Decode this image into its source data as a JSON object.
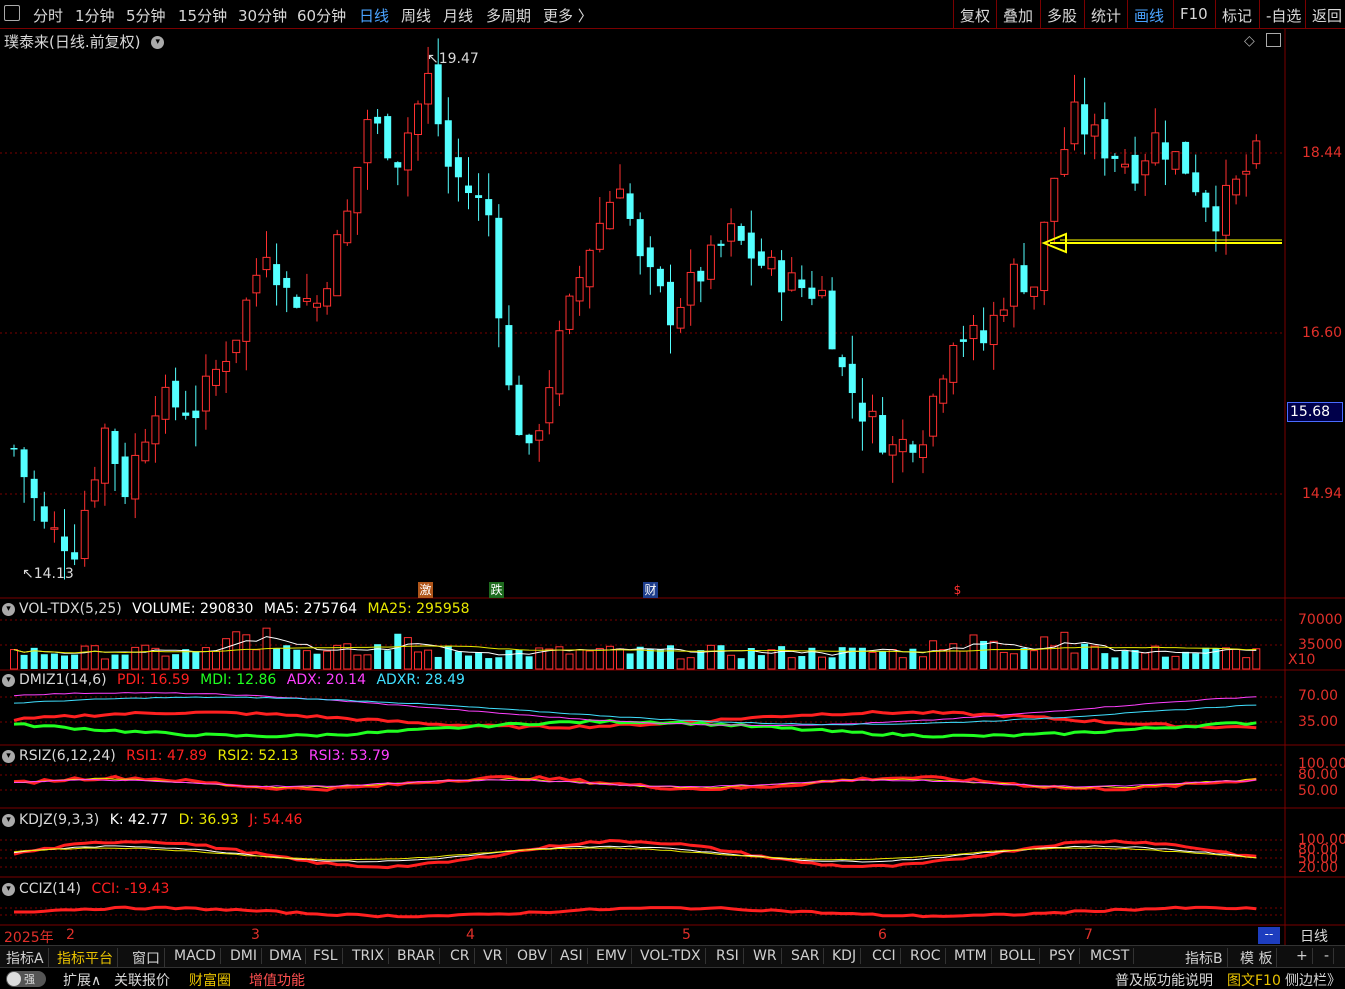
{
  "topbar": {
    "periods": [
      "分时",
      "1分钟",
      "5分钟",
      "15分钟",
      "30分钟",
      "60分钟",
      "日线",
      "周线",
      "月线",
      "多周期",
      "更多 〉"
    ],
    "active_period": "日线",
    "right_tools": [
      "复权",
      "叠加",
      "多股",
      "统计",
      "画线",
      "F10",
      "标记",
      "-自选",
      "返回"
    ],
    "highlighted_tool": "画线"
  },
  "main": {
    "title": "璞泰来(日线.前复权)",
    "high_label": "19.47",
    "low_label": "14.13",
    "axis": [
      "18.44",
      "16.60",
      "14.94"
    ],
    "current_price": "15.68",
    "markers": [
      "激",
      "跌",
      "财",
      "$"
    ]
  },
  "volume": {
    "name": "VOL-TDX(5,25)",
    "v1": "VOLUME: 290830",
    "v2": "MA5: 275764",
    "v3": "MA25: 295958",
    "axis": [
      "70000",
      "35000",
      "X10"
    ]
  },
  "dmi": {
    "name": "DMIZ1(14,6)",
    "v1": "PDI: 16.59",
    "v2": "MDI: 12.86",
    "v3": "ADX: 20.14",
    "v4": "ADXR: 28.49",
    "axis": [
      "70.00",
      "35.00"
    ]
  },
  "rsi": {
    "name": "RSIZ(6,12,24)",
    "v1": "RSI1: 47.89",
    "v2": "RSI2: 52.13",
    "v3": "RSI3: 53.79",
    "axis": [
      "100.00",
      "80.00",
      "50.00"
    ]
  },
  "kdj": {
    "name": "KDJZ(9,3,3)",
    "v1": "K: 42.77",
    "v2": "D: 36.93",
    "v3": "J: 54.46",
    "axis": [
      "100.00",
      "80.00",
      "50.00",
      "20.00"
    ]
  },
  "cci": {
    "name": "CCIZ(14)",
    "v1": "CCI: -19.43"
  },
  "dates": {
    "year": "2025年",
    "months": [
      "2",
      "3",
      "4",
      "5",
      "6",
      "7"
    ],
    "period": "日线",
    "dash": "--"
  },
  "indicator_tabs": [
    "指标A",
    "指标平台",
    "窗口",
    "MACD",
    "DMI",
    "DMA",
    "FSL",
    "TRIX",
    "BRAR",
    "CR",
    "VR",
    "OBV",
    "ASI",
    "EMV",
    "VOL-TDX",
    "RSI",
    "WR",
    "SAR",
    "KDJ",
    "CCI",
    "ROC",
    "MTM",
    "BOLL",
    "PSY",
    "MCST"
  ],
  "indicator_right": [
    "指标B",
    "模 板",
    "+",
    "-"
  ],
  "status": {
    "toggle": "强",
    "items": [
      "扩展∧",
      "关联报价",
      "财富圈",
      "增值功能"
    ],
    "right": [
      "普及版功能说明",
      "图文F10",
      "侧边栏》"
    ]
  },
  "colors": {
    "up": "#ff3030",
    "down": "#54ffff",
    "grid": "#7a0000",
    "ma5": "#ffffff",
    "ma25": "#e8e800",
    "pdi": "#ff2020",
    "mdi": "#20ff20",
    "adx": "#ff40ff",
    "adxr": "#40e0ff"
  }
}
